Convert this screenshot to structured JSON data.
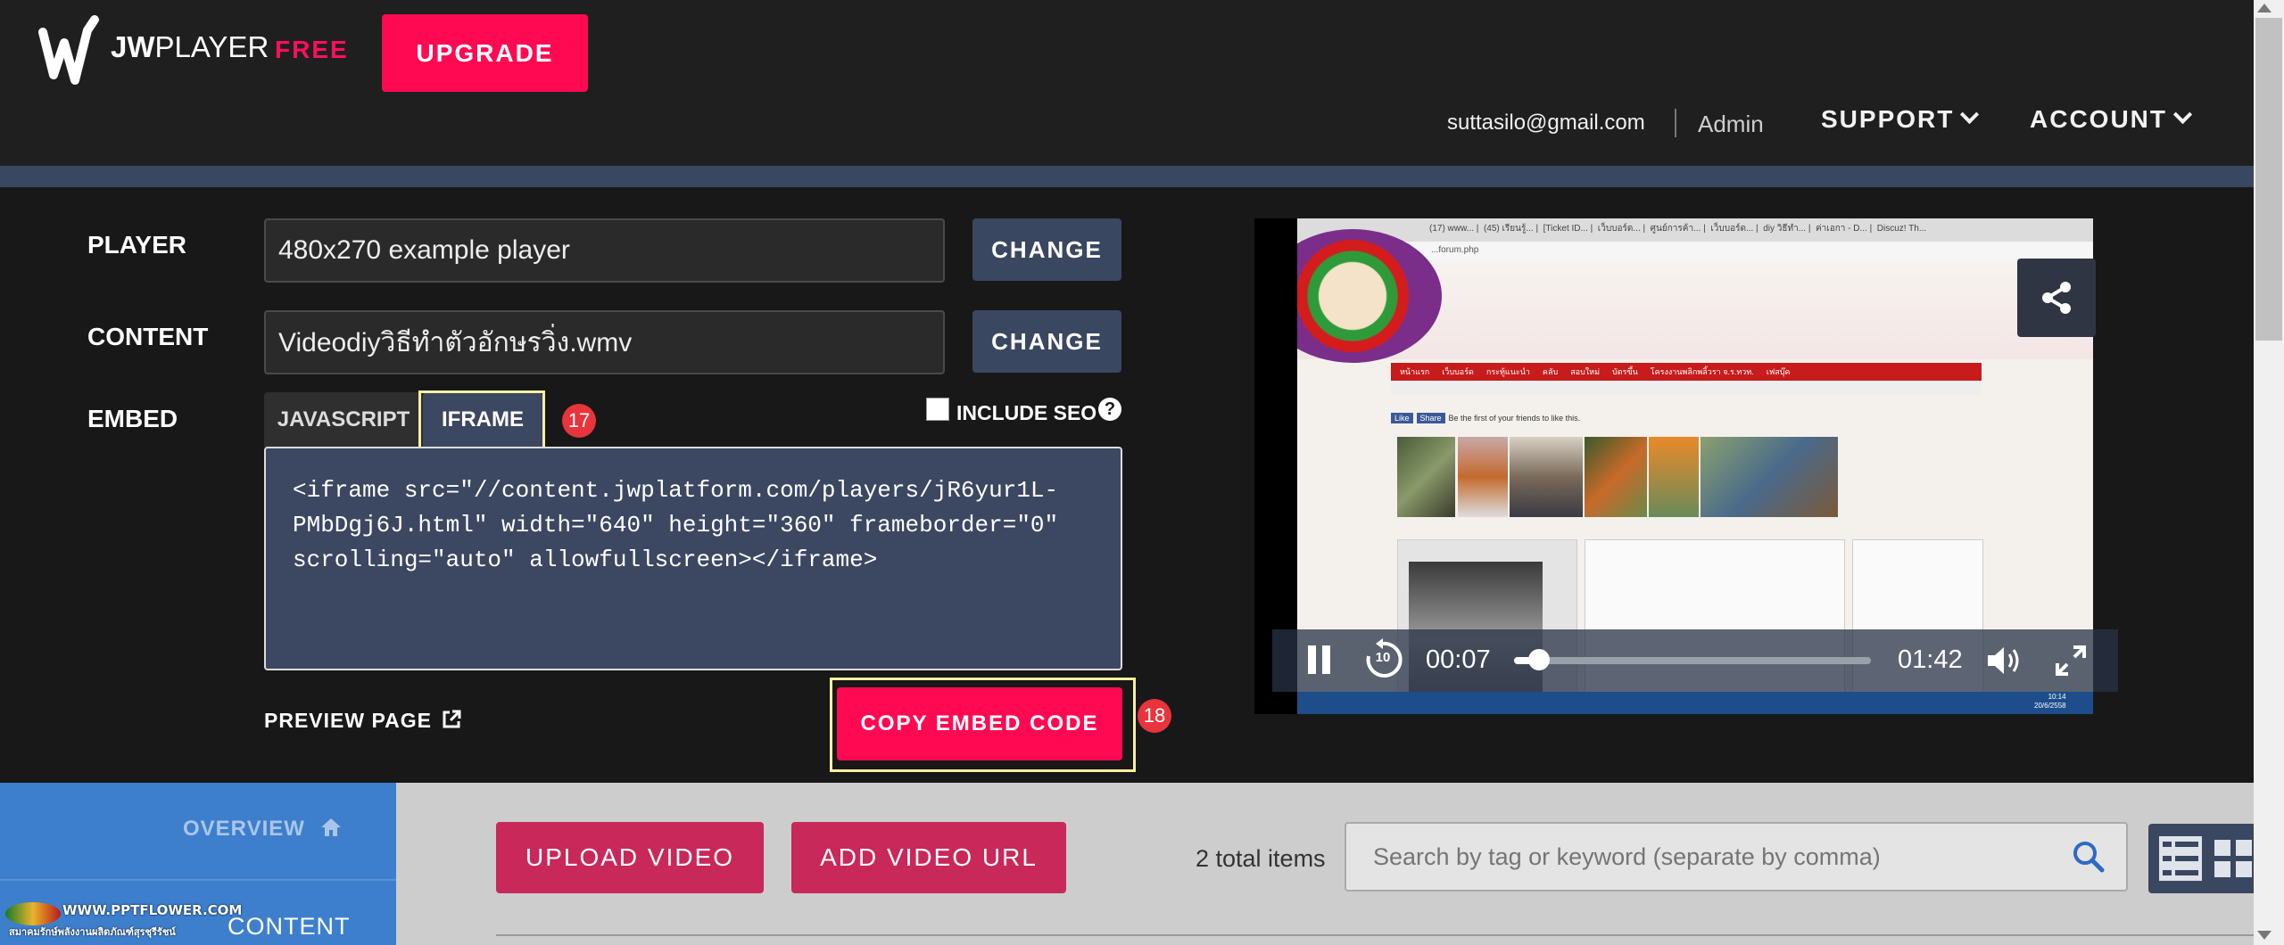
{
  "header": {
    "logo_text_bold": "JW",
    "logo_text": "PLAYER",
    "plan": "FREE",
    "upgrade_label": "UPGRADE",
    "email": "suttasilo@gmail.com",
    "role": "Admin",
    "support_label": "SUPPORT",
    "account_label": "ACCOUNT"
  },
  "embed_panel": {
    "player_label": "PLAYER",
    "player_value": "480x270 example player",
    "content_label": "CONTENT",
    "content_value": "Videodiyวิธีทำตัวอักษรวิ่ง.wmv",
    "change_label": "CHANGE",
    "embed_label": "EMBED",
    "tabs": [
      {
        "label": "JAVASCRIPT"
      },
      {
        "label": "IFRAME"
      }
    ],
    "include_seo_label": "INCLUDE SEO",
    "help_glyph": "?",
    "code": "<iframe src=\"//content.jwplatform.com/players/jR6yur1L-\nPMbDgj6J.html\" width=\"640\" height=\"360\" frameborder=\"0\"\nscrolling=\"auto\" allowfullscreen></iframe>",
    "preview_label": "PREVIEW PAGE",
    "copy_label": "COPY EMBED CODE",
    "badge_tab": "17",
    "badge_copy": "18"
  },
  "player": {
    "elapsed": "00:07",
    "duration": "01:42",
    "progress": 0.07,
    "rewind_label": "10",
    "screen_url": "...forum.php",
    "screen_tabs": [
      "(17) www...",
      "(45) เรียนรู้...",
      "[Ticket ID...",
      "เว็บบอร์ด...",
      "ศูนย์การค้า...",
      "เว็บบอร์ด...",
      "diy วิธีทำ...",
      "ค่าเอกา - D...",
      "Discuz! Th..."
    ],
    "screen_menu": [
      "หน้าแรก",
      "เว็บบอร์ด",
      "กระทู้แนะนำ",
      "คลับ",
      "สอบใหม่",
      "บัตรขึ้น",
      "โครงงานพลิกพลิ้วรา จ.ร.ทวท.",
      "เฟสบุ๊ค"
    ],
    "screen_like": "Like",
    "screen_share": "Share",
    "screen_like_text": "Be the first of your friends to like this.",
    "screen_clock": "10:14",
    "screen_date": "20/6/2558"
  },
  "sidebar": {
    "overview_label": "OVERVIEW",
    "content_label": "CONTENT",
    "watermark_line1": "WWW.PPTFLOWER.COM",
    "watermark_line2": "สมาคมรักษ์พลังงานผลิตภัณฑ์สุรชุรีรัชน์"
  },
  "library": {
    "upload_label": "UPLOAD VIDEO",
    "add_url_label": "ADD VIDEO URL",
    "total_items": "2 total items",
    "search_placeholder": "Search by tag or keyword (separate by comma)"
  },
  "colors": {
    "brand_red": "#ff0a52",
    "accent_navy": "#3a4760",
    "sidebar_blue": "#3d7fcc",
    "highlight": "#f5f0a0"
  }
}
